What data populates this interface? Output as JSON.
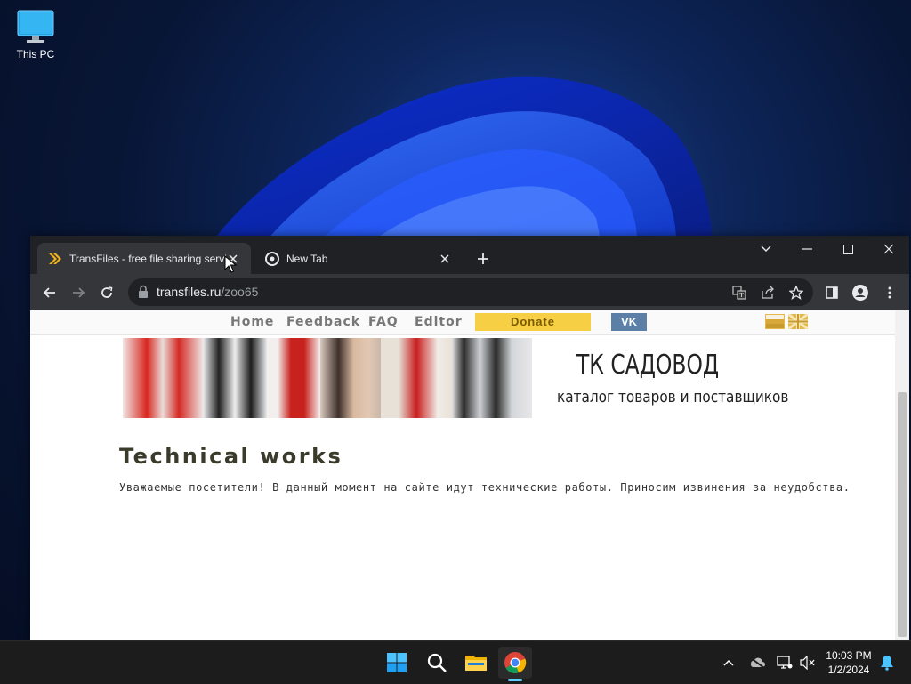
{
  "desktop": {
    "icons": [
      {
        "label": "This PC",
        "icon": "monitor-icon"
      }
    ]
  },
  "browser": {
    "tabs": [
      {
        "title": "TransFiles - free file sharing servic",
        "icon": "transfiles-favicon-icon",
        "active": true
      },
      {
        "title": "New Tab",
        "icon": "chrome-icon",
        "active": false
      }
    ],
    "address": {
      "domain": "transfiles.ru",
      "path": "/zoo65"
    }
  },
  "page": {
    "nav": {
      "links": [
        "Home",
        "Feedback",
        "FAQ",
        "Editor"
      ],
      "donate": "Donate",
      "vk": "VK"
    },
    "brand": {
      "title": "ТК САДОВОД",
      "subtitle": "каталог товаров и поставщиков"
    },
    "heading": "Technical works",
    "notice": "Уважаемые посетители! В данный момент на сайте идут технические работы. Приносим извинения за неудобства.",
    "colors": {
      "donate": "#f7cf45",
      "vk": "#5b7fa6"
    }
  },
  "taskbar": {
    "apps": [
      "windows-start-icon",
      "search-icon",
      "file-explorer-icon",
      "chrome-icon"
    ],
    "clock": {
      "time": "10:03 PM",
      "date": "1/2/2024"
    }
  }
}
